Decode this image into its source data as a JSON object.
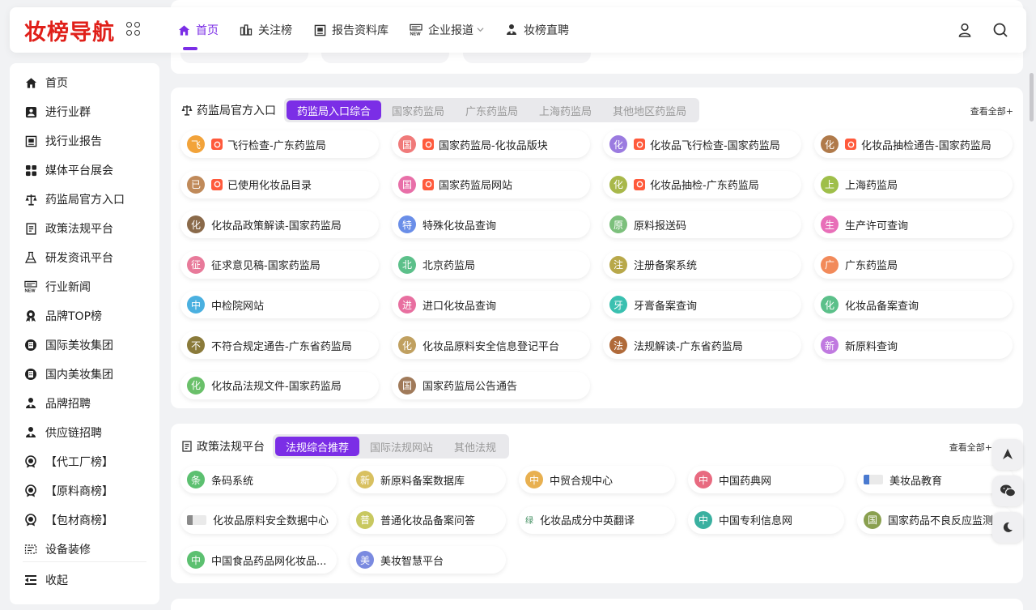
{
  "header": {
    "logo": "妆榜导航",
    "nav": [
      {
        "label": "首页",
        "icon": "home-icon",
        "active": true
      },
      {
        "label": "关注榜",
        "icon": "chart-icon",
        "active": false
      },
      {
        "label": "报告资料库",
        "icon": "report-icon",
        "active": false
      },
      {
        "label": "企业报道",
        "icon": "news-icon",
        "active": false
      },
      {
        "label": "妆榜直聘",
        "icon": "recruit-icon",
        "active": false
      }
    ]
  },
  "sidebar": {
    "items": [
      {
        "label": "首页",
        "icon": "home-icon"
      },
      {
        "label": "进行业群",
        "icon": "group-icon"
      },
      {
        "label": "找行业报告",
        "icon": "report-icon"
      },
      {
        "label": "媒体平台展会",
        "icon": "apps-icon"
      },
      {
        "label": "药监局官方入口",
        "icon": "scale-icon"
      },
      {
        "label": "政策法规平台",
        "icon": "document-icon"
      },
      {
        "label": "研发资讯平台",
        "icon": "flask-icon"
      },
      {
        "label": "行业新闻",
        "icon": "news-icon"
      },
      {
        "label": "品牌TOP榜",
        "icon": "trophy-icon"
      },
      {
        "label": "国际美妆集团",
        "icon": "building-icon"
      },
      {
        "label": "国内美妆集团",
        "icon": "building-icon"
      },
      {
        "label": "品牌招聘",
        "icon": "recruit-icon"
      },
      {
        "label": "供应链招聘",
        "icon": "recruit-icon"
      },
      {
        "label": "【代工厂榜】",
        "icon": "medal-icon"
      },
      {
        "label": "【原料商榜】",
        "icon": "medal-icon"
      },
      {
        "label": "【包材商榜】",
        "icon": "medal-icon"
      },
      {
        "label": "设备装修",
        "icon": "tools-icon"
      }
    ],
    "collapse_label": "收起"
  },
  "fda_panel": {
    "title": "药监局官方入口",
    "tabs": [
      "药监局入口综合",
      "国家药监局",
      "广东药监局",
      "上海药监局",
      "其他地区药监局"
    ],
    "view_all": "查看全部+",
    "cards": [
      {
        "char": "飞",
        "label": "飞行检查-广东药监局",
        "badge": true,
        "color": "#f2a33a"
      },
      {
        "char": "国",
        "label": "国家药监局-化妆品版块",
        "badge": true,
        "color": "#f07a7a"
      },
      {
        "char": "化",
        "label": "化妆品飞行检查-国家药监局",
        "badge": true,
        "color": "#9b7be0"
      },
      {
        "char": "化",
        "label": "化妆品抽检通告-国家药监局",
        "badge": true,
        "color": "#b07a4a"
      },
      {
        "char": "已",
        "label": "已使用化妆品目录",
        "badge": true,
        "color": "#c08a5a"
      },
      {
        "char": "国",
        "label": "国家药监局网站",
        "badge": true,
        "color": "#e86fa8"
      },
      {
        "char": "化",
        "label": "化妆品抽检-广东药监局",
        "badge": true,
        "color": "#a8b84a"
      },
      {
        "char": "上",
        "label": "上海药监局",
        "badge": false,
        "color": "#9fbf4a"
      },
      {
        "char": "化",
        "label": "化妆品政策解读-国家药监局",
        "badge": false,
        "color": "#8a6a4a"
      },
      {
        "char": "特",
        "label": "特殊化妆品查询",
        "badge": false,
        "color": "#6a8ee8"
      },
      {
        "char": "原",
        "label": "原料报送码",
        "badge": false,
        "color": "#7cc07c"
      },
      {
        "char": "生",
        "label": "生产许可查询",
        "badge": false,
        "color": "#e86fb8"
      },
      {
        "char": "征",
        "label": "征求意见稿-国家药监局",
        "badge": false,
        "color": "#e87a9a"
      },
      {
        "char": "北",
        "label": "北京药监局",
        "badge": false,
        "color": "#5cc08a"
      },
      {
        "char": "注",
        "label": "注册备案系统",
        "badge": false,
        "color": "#b8a84a"
      },
      {
        "char": "广",
        "label": "广东药监局",
        "badge": false,
        "color": "#f28a5a"
      },
      {
        "char": "中",
        "label": "中检院网站",
        "badge": false,
        "color": "#4ab0e0"
      },
      {
        "char": "进",
        "label": "进口化妆品查询",
        "badge": false,
        "color": "#e86fa0"
      },
      {
        "char": "牙",
        "label": "牙膏备案查询",
        "badge": false,
        "color": "#3ac0b0"
      },
      {
        "char": "化",
        "label": "化妆品备案查询",
        "badge": false,
        "color": "#5cc08a"
      },
      {
        "char": "不",
        "label": "不符合规定通告-广东省药监局",
        "badge": false,
        "color": "#8a7a3a"
      },
      {
        "char": "化",
        "label": "化妆品原料安全信息登记平台",
        "badge": false,
        "color": "#c0a060"
      },
      {
        "char": "法",
        "label": "法规解读-广东省药监局",
        "badge": false,
        "color": "#b06a3a"
      },
      {
        "char": "新",
        "label": "新原料查询",
        "badge": false,
        "color": "#c07ae0"
      },
      {
        "char": "化",
        "label": "化妆品法规文件-国家药监局",
        "badge": false,
        "color": "#6ac06a"
      },
      {
        "char": "国",
        "label": "国家药监局公告通告",
        "badge": false,
        "color": "#a07a5a"
      }
    ]
  },
  "policy_panel": {
    "title": "政策法规平台",
    "tabs": [
      "法规综合推荐",
      "国际法规网站",
      "其他法规"
    ],
    "view_all": "查看全部+",
    "cards": [
      {
        "char": "条",
        "label": "条码系统",
        "color": "#5cc070"
      },
      {
        "char": "新",
        "label": "新原料备案数据库",
        "color": "#d8c060"
      },
      {
        "char": "中",
        "label": "中贸合规中心",
        "color": "#e8b050"
      },
      {
        "char": "中",
        "label": "中国药典网",
        "color": "#e86a80"
      },
      {
        "char": "",
        "label": "美妆品教育",
        "color": "#4a7ad0",
        "logo": true
      },
      {
        "char": "",
        "label": "化妆品原料安全数据中心",
        "color": "#8a8a8a",
        "logo": true
      },
      {
        "char": "普",
        "label": "普通化妆品备案问答",
        "color": "#c8c860"
      },
      {
        "char": "绿",
        "label": "化妆品成分中英翻译",
        "color": "#3a8a5a",
        "logo": true
      },
      {
        "char": "中",
        "label": "中国专利信息网",
        "color": "#3ab0a0"
      },
      {
        "char": "国",
        "label": "国家药品不良反应监测",
        "color": "#8aa050"
      },
      {
        "char": "中",
        "label": "中国食品药品网化妆品...",
        "color": "#5cc070"
      },
      {
        "char": "美",
        "label": "美妆智慧平台",
        "color": "#7a8ae0"
      }
    ]
  }
}
